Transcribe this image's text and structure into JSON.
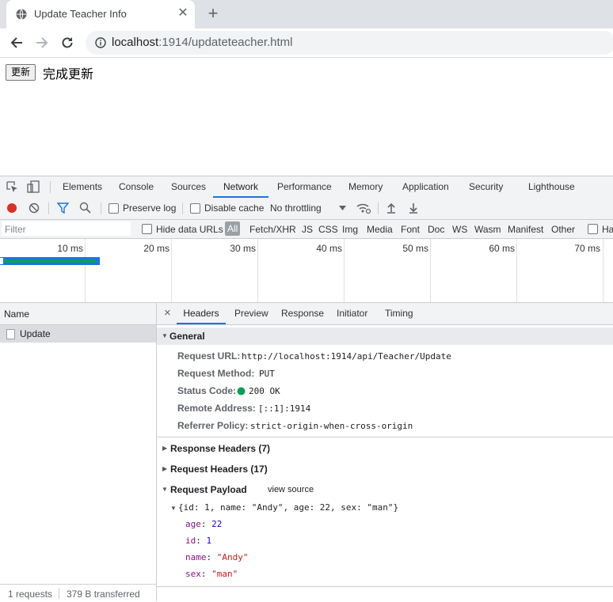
{
  "browser": {
    "tab_title": "Update Teacher Info",
    "tab_close": "✕",
    "new_tab": "+",
    "url_host": "localhost",
    "url_rest": ":1914/updateteacher.html"
  },
  "page": {
    "button_label": "更新",
    "status_text": "完成更新"
  },
  "devtools": {
    "tabs": [
      "Elements",
      "Console",
      "Sources",
      "Network",
      "Performance",
      "Memory",
      "Application",
      "Security",
      "Lighthouse"
    ],
    "active_tab": "Network",
    "toolbar": {
      "preserve_log": "Preserve log",
      "disable_cache": "Disable cache",
      "throttling": "No throttling"
    },
    "filter": {
      "placeholder": "Filter",
      "hide_data_urls": "Hide data URLs",
      "types": [
        "All",
        "Fetch/XHR",
        "JS",
        "CSS",
        "Img",
        "Media",
        "Font",
        "Doc",
        "WS",
        "Wasm",
        "Manifest",
        "Other"
      ],
      "cut_label": "Ha"
    },
    "timeline": {
      "ticks": [
        "10 ms",
        "20 ms",
        "30 ms",
        "40 ms",
        "50 ms",
        "60 ms",
        "70 ms"
      ]
    },
    "requests": {
      "header": "Name",
      "items": [
        "Update"
      ],
      "summary_count": "1 requests",
      "summary_transfer": "379 B transferred"
    },
    "detail": {
      "close": "×",
      "tabs": [
        "Headers",
        "Preview",
        "Response",
        "Initiator",
        "Timing"
      ],
      "active_tab": "Headers",
      "general": {
        "title": "General",
        "request_url_key": "Request URL:",
        "request_url": "http://localhost:1914/api/Teacher/Update",
        "method_key": "Request Method:",
        "method": "PUT",
        "status_key": "Status Code:",
        "status": "200 OK",
        "remote_key": "Remote Address:",
        "remote": "[::1]:1914",
        "referrer_key": "Referrer Policy:",
        "referrer": "strict-origin-when-cross-origin"
      },
      "response_headers": "Response Headers (7)",
      "request_headers": "Request Headers (17)",
      "payload": {
        "title": "Request Payload",
        "view_source": "view source",
        "summary": "{id: 1, name: \"Andy\", age: 22, sex: \"man\"}",
        "age_key": "age",
        "age_val": "22",
        "id_key": "id",
        "id_val": "1",
        "name_key": "name",
        "name_val": "\"Andy\"",
        "sex_key": "sex",
        "sex_val": "\"man\""
      }
    }
  },
  "colors": {
    "accent": "#1a73e8",
    "status_ok": "#0f9d58",
    "record": "#d93025"
  }
}
